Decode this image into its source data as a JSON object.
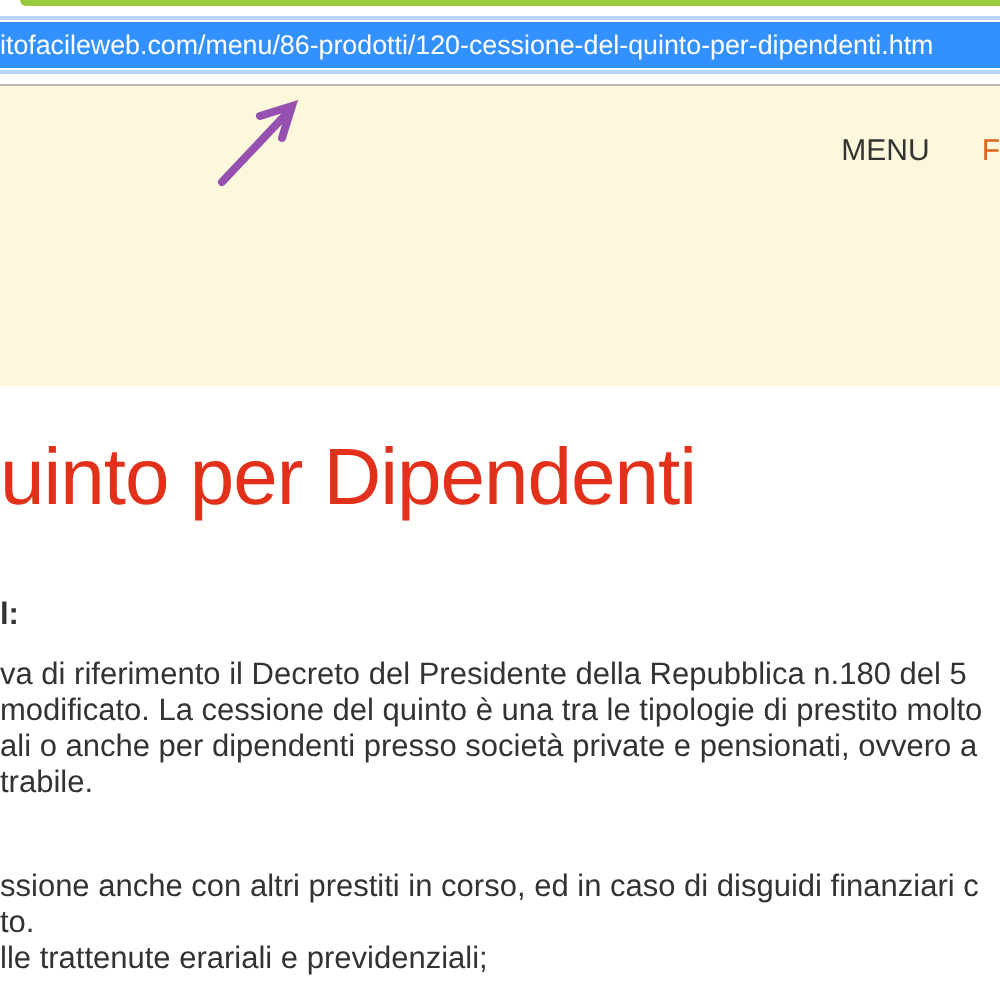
{
  "address_bar": {
    "url": "itofacileweb.com/menu/86-prodotti/120-cessione-del-quinto-per-dipendenti.htm"
  },
  "nav": [
    {
      "label": "MENU",
      "selected": false
    },
    {
      "label": "F",
      "selected": true
    }
  ],
  "heading": "uinto per Dipendenti",
  "subheading": "l:",
  "paragraphs": [
    {
      "lines": [
        "va di riferimento il Decreto del Presidente della Repubblica n.180 del 5",
        "modificato. La cessione del quinto è una tra le tipologie di prestito molto",
        "ali o anche per dipendenti presso società private e pensionati, ovvero a",
        "trabile."
      ]
    },
    {
      "lines": [
        "ssione anche con altri prestiti in corso, ed in caso di disguidi finanziari c",
        "to.",
        "lle trattenute erariali e previdenziali;"
      ]
    }
  ]
}
